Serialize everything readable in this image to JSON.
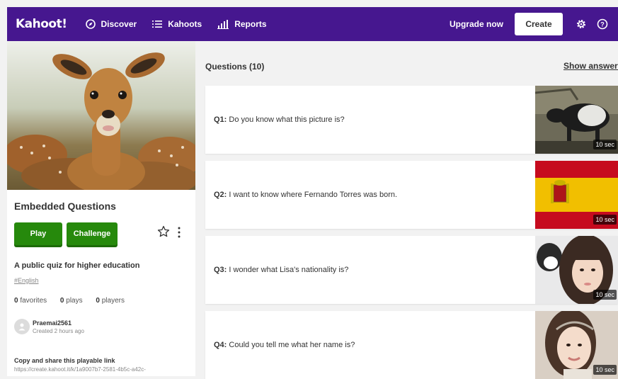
{
  "nav": {
    "logo": "Kahoot!",
    "discover": "Discover",
    "kahoots": "Kahoots",
    "reports": "Reports",
    "upgrade": "Upgrade now",
    "create": "Create"
  },
  "kahoot": {
    "title": "Embedded Questions",
    "play": "Play",
    "challenge": "Challenge",
    "description": "A public quiz for higher education",
    "tag": "#English",
    "favorites_count": "0",
    "favorites_label": "favorites",
    "plays_count": "0",
    "plays_label": "plays",
    "players_count": "0",
    "players_label": "players",
    "author": "Praemai2561",
    "created": "Created 2 hours ago",
    "share_title": "Copy and share this playable link",
    "share_link": "https://create.kahoot.it/k/1a9007b7-2581-4b5c-a42c-"
  },
  "questions_header": "Questions (10)",
  "show_answers": "Show answers",
  "questions": [
    {
      "num": "Q1:",
      "text": "Do you know what this picture is?",
      "time": "10 sec"
    },
    {
      "num": "Q2:",
      "text": "I want to know where Fernando Torres was born.",
      "time": "10 sec"
    },
    {
      "num": "Q3:",
      "text": "I wonder what Lisa's nationality is?",
      "time": "10 sec"
    },
    {
      "num": "Q4:",
      "text": "Could you tell me what her name is?",
      "time": "10 sec"
    }
  ],
  "colors": {
    "nav_bg": "#46178f",
    "play_green": "#26890c",
    "page_bg": "#f2f2f2"
  }
}
